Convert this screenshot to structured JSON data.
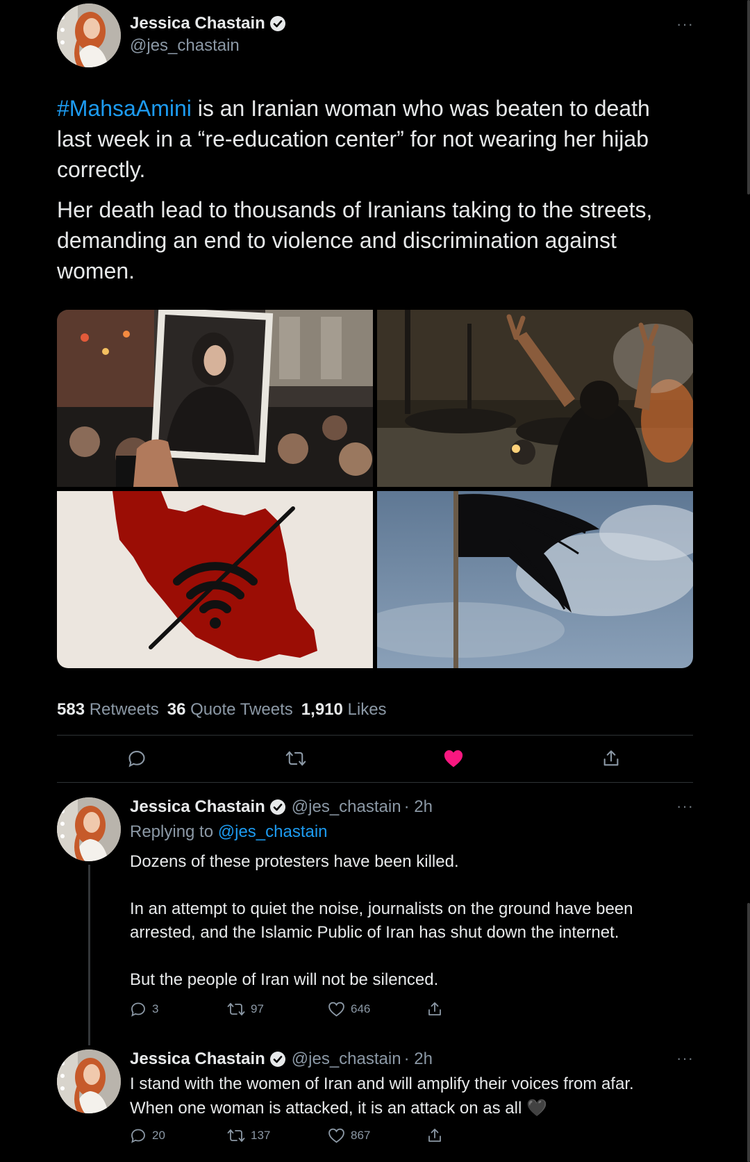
{
  "main_tweet": {
    "author_name": "Jessica Chastain",
    "author_handle": "@jes_chastain",
    "hashtag": "#MahsaAmini",
    "text_line1_rest": " is an Iranian woman who was beaten to death",
    "text_line2": "last week in a “re-education center” for not wearing her hijab",
    "text_line3": "correctly.",
    "para2_line1": "Her death lead to thousands of Iranians taking to the streets,",
    "para2_line2": "demanding an end to violence and discrimination against",
    "para2_line3": "women.",
    "retweets_count": "583",
    "retweets_label": "Retweets",
    "quotes_count": "36",
    "quotes_label": "Quote Tweets",
    "likes_count": "1,910",
    "likes_label": "Likes",
    "liked_color": "#f91880"
  },
  "reply1": {
    "author_name": "Jessica Chastain",
    "author_handle": "@jes_chastain",
    "time": "· 2h",
    "replying_prefix": "Replying to",
    "replying_handle": "@jes_chastain",
    "para1": "Dozens of these protesters have been killed.",
    "para2_line1": "In an attempt to quiet the noise, journalists on the ground have been",
    "para2_line2": "arrested, and the Islamic Public of Iran has shut down the internet.",
    "para3": "But the people of Iran will not be silenced.",
    "replies": "3",
    "retweets": "97",
    "likes": "646"
  },
  "reply2": {
    "author_name": "Jessica Chastain",
    "author_handle": "@jes_chastain",
    "time": "· 2h",
    "line1": "I stand with the women of Iran and will amplify their voices from afar.",
    "line2": "When one woman is attacked, it is an attack on as all",
    "emoji": "🖤",
    "replies": "20",
    "retweets": "137",
    "likes": "867"
  },
  "more_label": "···",
  "accent_color": "#1d9bf0"
}
